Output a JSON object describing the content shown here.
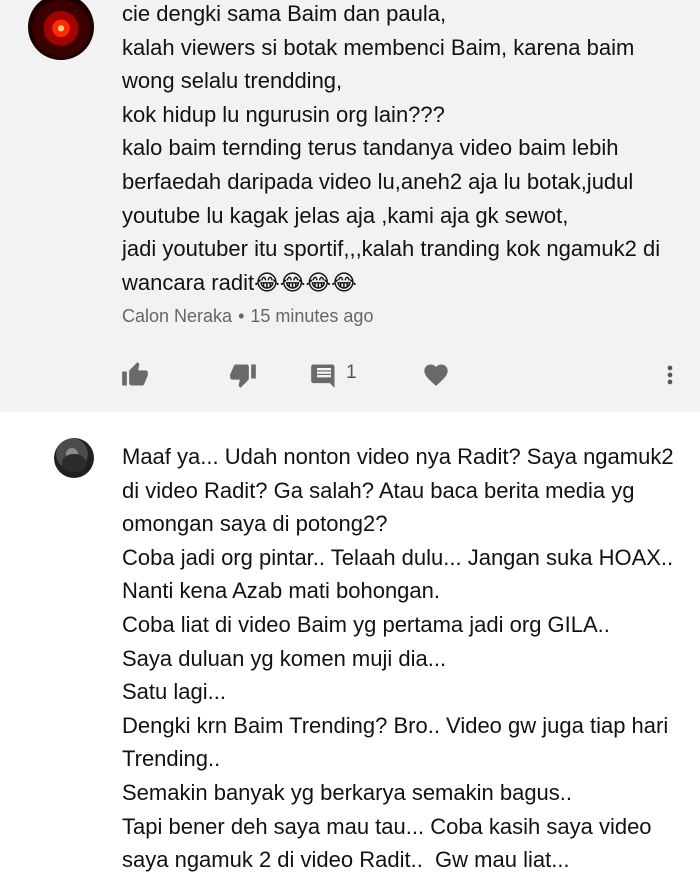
{
  "comments": [
    {
      "avatar": "red-eye-avatar",
      "text": "cie dengki sama Baim dan paula,\nkalah viewers si botak membenci Baim, karena baim wong selalu trendding,\nkok hidup lu ngurusin org lain???\nkalo baim ternding terus tandanya video baim lebih berfaedah daripada video lu,aneh2 aja lu botak,judul youtube lu kagak jelas aja ,kami aja gk sewot,\njadi youtuber itu sportif,,,kalah tranding kok ngamuk2 di wancara radit😂😂😂😂",
      "author": "Calon Neraka",
      "time": "15 minutes ago",
      "reply_count": "1",
      "icons": {
        "like": "thumbs-up-icon",
        "dislike": "thumbs-down-icon",
        "reply": "comment-icon",
        "heart": "heart-icon",
        "more": "more-vertical-icon"
      }
    },
    {
      "avatar": "profile-avatar",
      "text": "Maaf ya... Udah nonton video nya Radit? Saya ngamuk2 di video Radit? Ga salah? Atau baca berita media yg omongan saya di potong2?\nCoba jadi org pintar.. Telaah dulu... Jangan suka HOAX.. Nanti kena Azab mati bohongan.\nCoba liat di video Baim yg pertama jadi org GILA..\nSaya duluan yg komen muji dia...\nSatu lagi...\nDengki krn Baim Trending? Bro.. Video gw juga tiap hari Trending..\nSemakin banyak yg berkarya semakin bagus..\nTapi bener deh saya mau tau... Coba kasih saya video saya ngamuk 2 di video Radit..  Gw mau liat..."
    }
  ],
  "colors": {
    "top_background": "#f2f2f2",
    "icon": "#6a6a6a",
    "meta": "#666666"
  }
}
